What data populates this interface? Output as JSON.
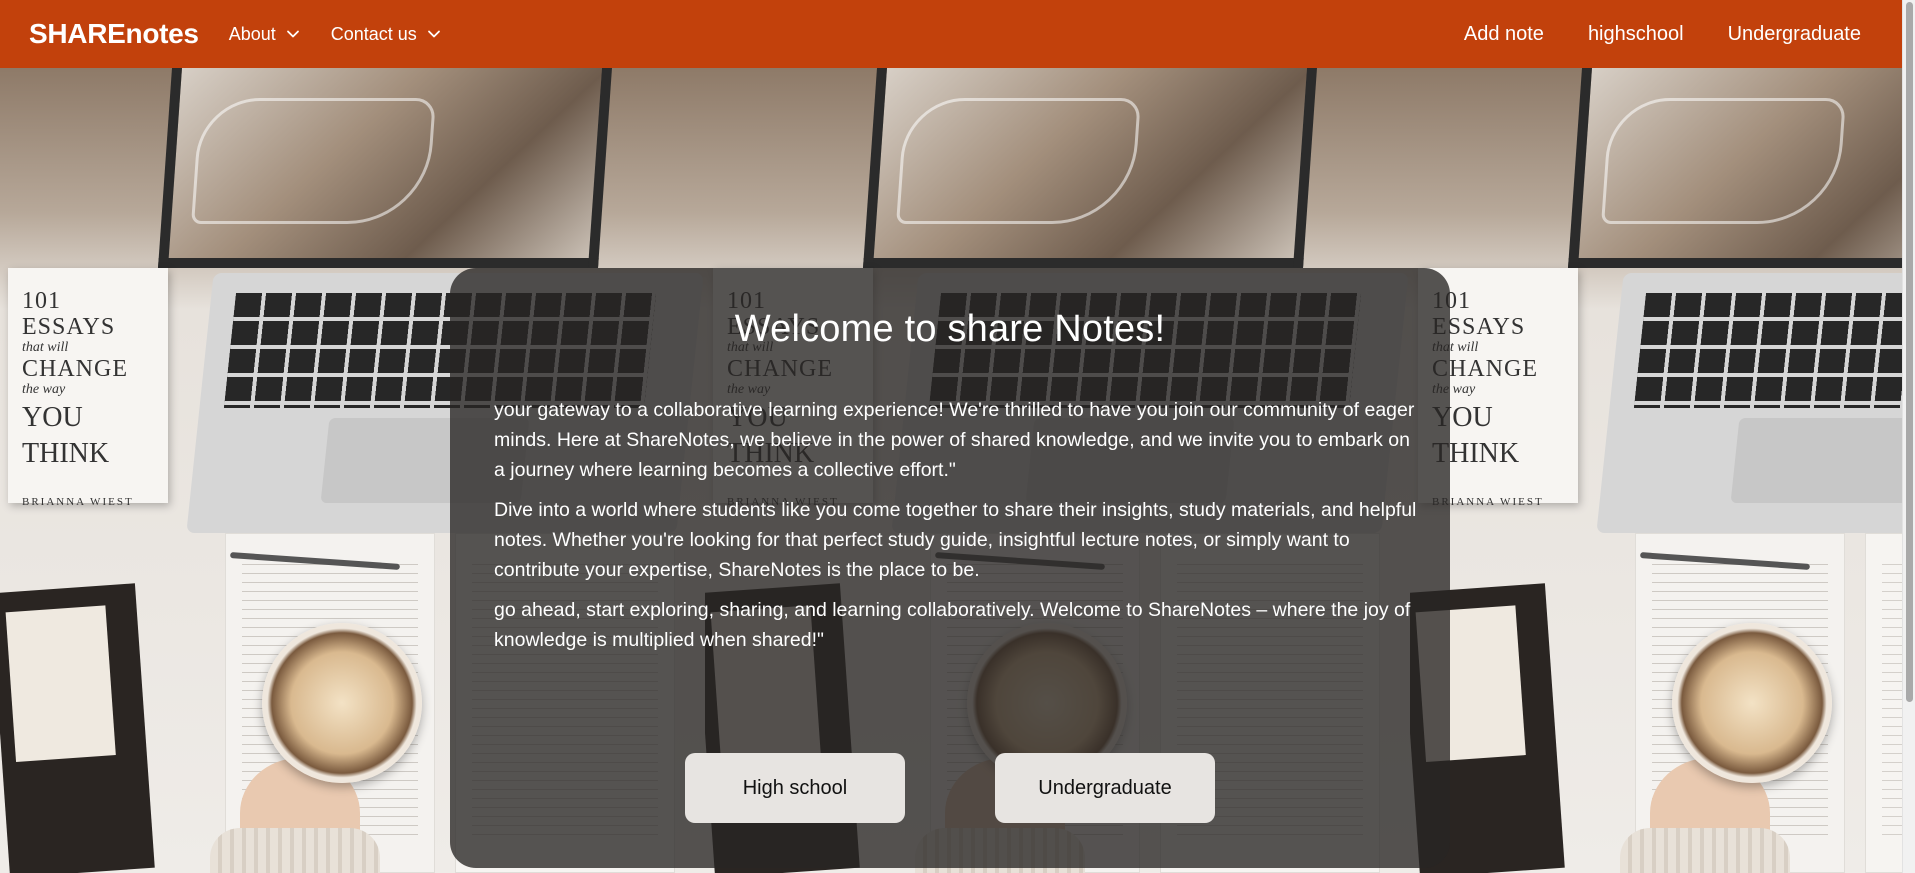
{
  "navbar": {
    "brand": "SHAREnotes",
    "dropdowns": [
      {
        "label": "About"
      },
      {
        "label": "Contact us"
      }
    ],
    "links": [
      {
        "label": "Add note"
      },
      {
        "label": "highschool"
      },
      {
        "label": "Undergraduate"
      }
    ]
  },
  "hero": {
    "background_image_text": {
      "book_line1": "101",
      "book_line2": "ESSAYS",
      "book_line3": "that will",
      "book_line4": "CHANGE",
      "book_line5": "the way",
      "book_line6": "YOU",
      "book_line7": "THINK",
      "book_author": "BRIANNA WIEST"
    }
  },
  "welcome": {
    "title": "Welcome to share Notes!",
    "paragraphs": [
      "your gateway to a collaborative learning experience! We're thrilled to have you join our community of eager minds. Here at ShareNotes, we believe in the power of shared knowledge, and we invite you to embark on a journey where learning becomes a collective effort.\"",
      "Dive into a world where students like you come together to share their insights, study materials, and helpful notes. Whether you're looking for that perfect study guide, insightful lecture notes, or simply want to contribute your expertise, ShareNotes is the place to be.",
      "go ahead, start exploring, sharing, and learning collaboratively. Welcome to ShareNotes – where the joy of knowledge is multiplied when shared!\""
    ],
    "buttons": [
      {
        "label": "High school"
      },
      {
        "label": "Undergraduate"
      }
    ]
  },
  "colors": {
    "navbar_bg": "#c2410c",
    "card_bg": "rgba(40,37,36,0.78)",
    "button_bg": "#e7e4e1"
  },
  "icons": {
    "dropdown": "chevron-down-icon"
  }
}
